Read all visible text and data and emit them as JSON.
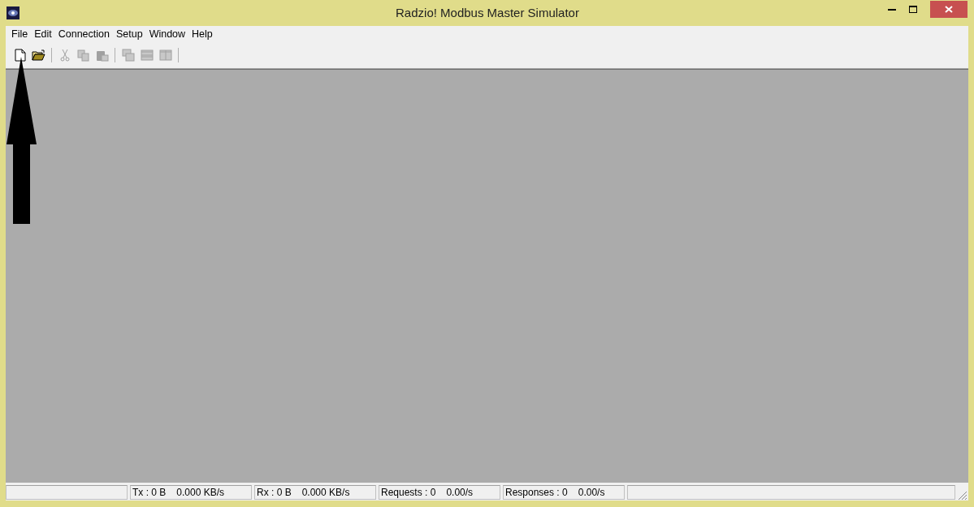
{
  "window": {
    "title": "Radzio! Modbus Master Simulator"
  },
  "menu": [
    "File",
    "Edit",
    "Connection",
    "Setup",
    "Window",
    "Help"
  ],
  "toolbar": [
    {
      "kind": "new",
      "disabled": false
    },
    {
      "kind": "open",
      "disabled": false
    },
    {
      "kind": "separator"
    },
    {
      "kind": "cut",
      "disabled": true
    },
    {
      "kind": "copy",
      "disabled": true
    },
    {
      "kind": "paste",
      "disabled": true
    },
    {
      "kind": "separator"
    },
    {
      "kind": "cascade",
      "disabled": true
    },
    {
      "kind": "tile-horizontal",
      "disabled": true
    },
    {
      "kind": "tile-vertical",
      "disabled": true
    },
    {
      "kind": "separator"
    }
  ],
  "status_bar": [
    {
      "texts": [
        "Tx : 0 B",
        "0.000 KB/s"
      ]
    },
    {
      "texts": [
        "Rx : 0 B",
        "0.000 KB/s"
      ]
    },
    {
      "texts": [
        "Requests : 0",
        "0.00/s"
      ]
    },
    {
      "texts": [
        "Responses : 0",
        "0.00/s"
      ]
    }
  ]
}
